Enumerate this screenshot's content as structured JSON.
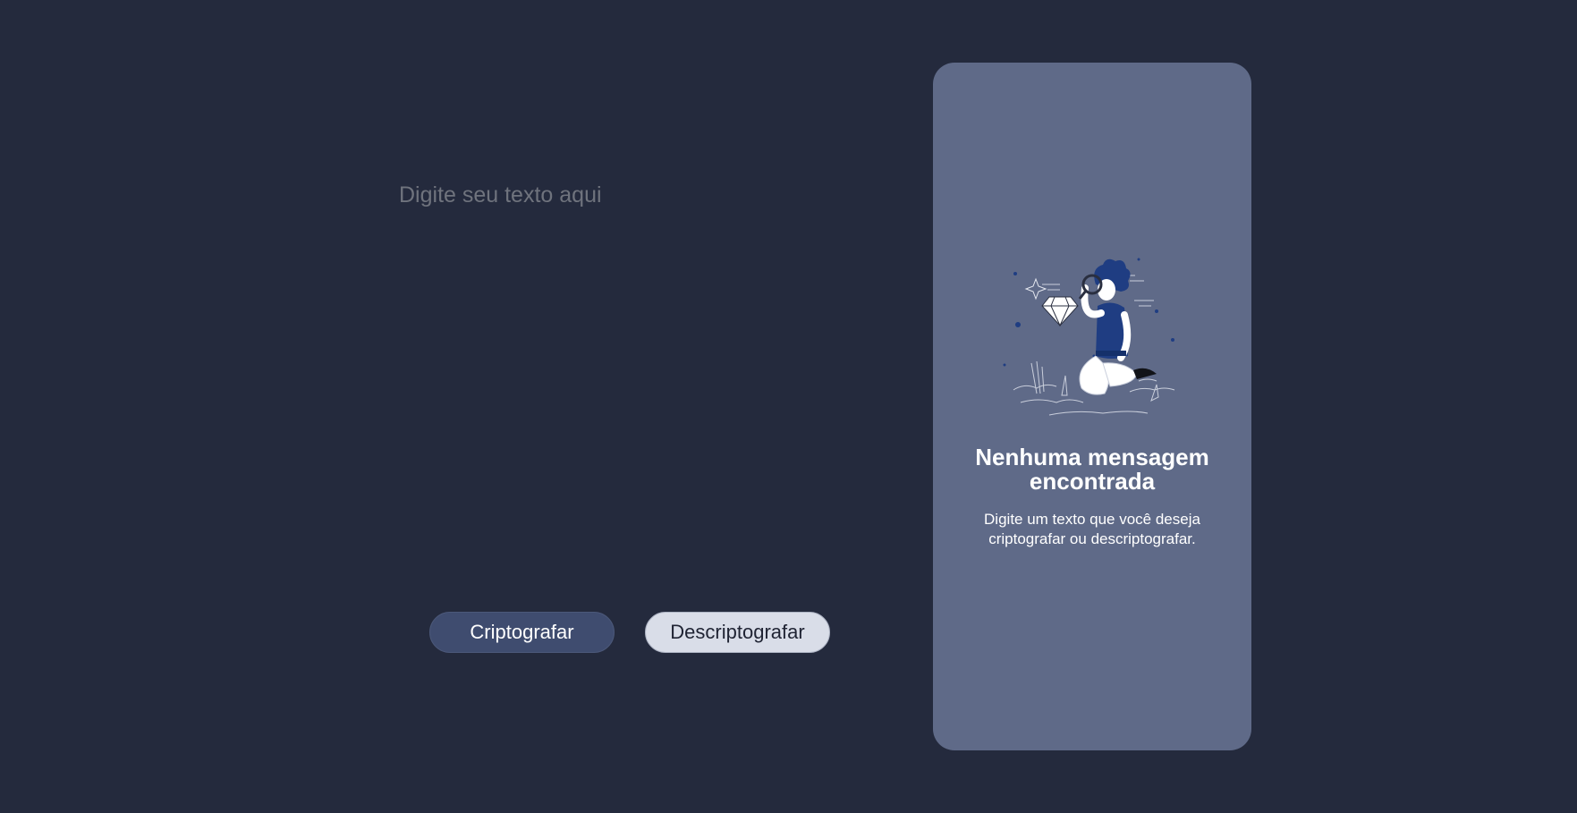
{
  "input": {
    "placeholder": "Digite seu texto aqui",
    "value": ""
  },
  "buttons": {
    "encrypt_label": "Criptografar",
    "decrypt_label": "Descriptografar"
  },
  "output_panel": {
    "illustration_icon": "person-with-magnifier-diamond-illustration",
    "title": "Nenhuma mensagem encontrada",
    "description": "Digite um texto que você deseja criptografar ou descriptografar."
  },
  "colors": {
    "background": "#242a3d",
    "panel": "#5f6a88",
    "encrypt_button": "#3f4c6f",
    "decrypt_button": "#d9dde8",
    "accent_blue": "#1f3d82"
  }
}
